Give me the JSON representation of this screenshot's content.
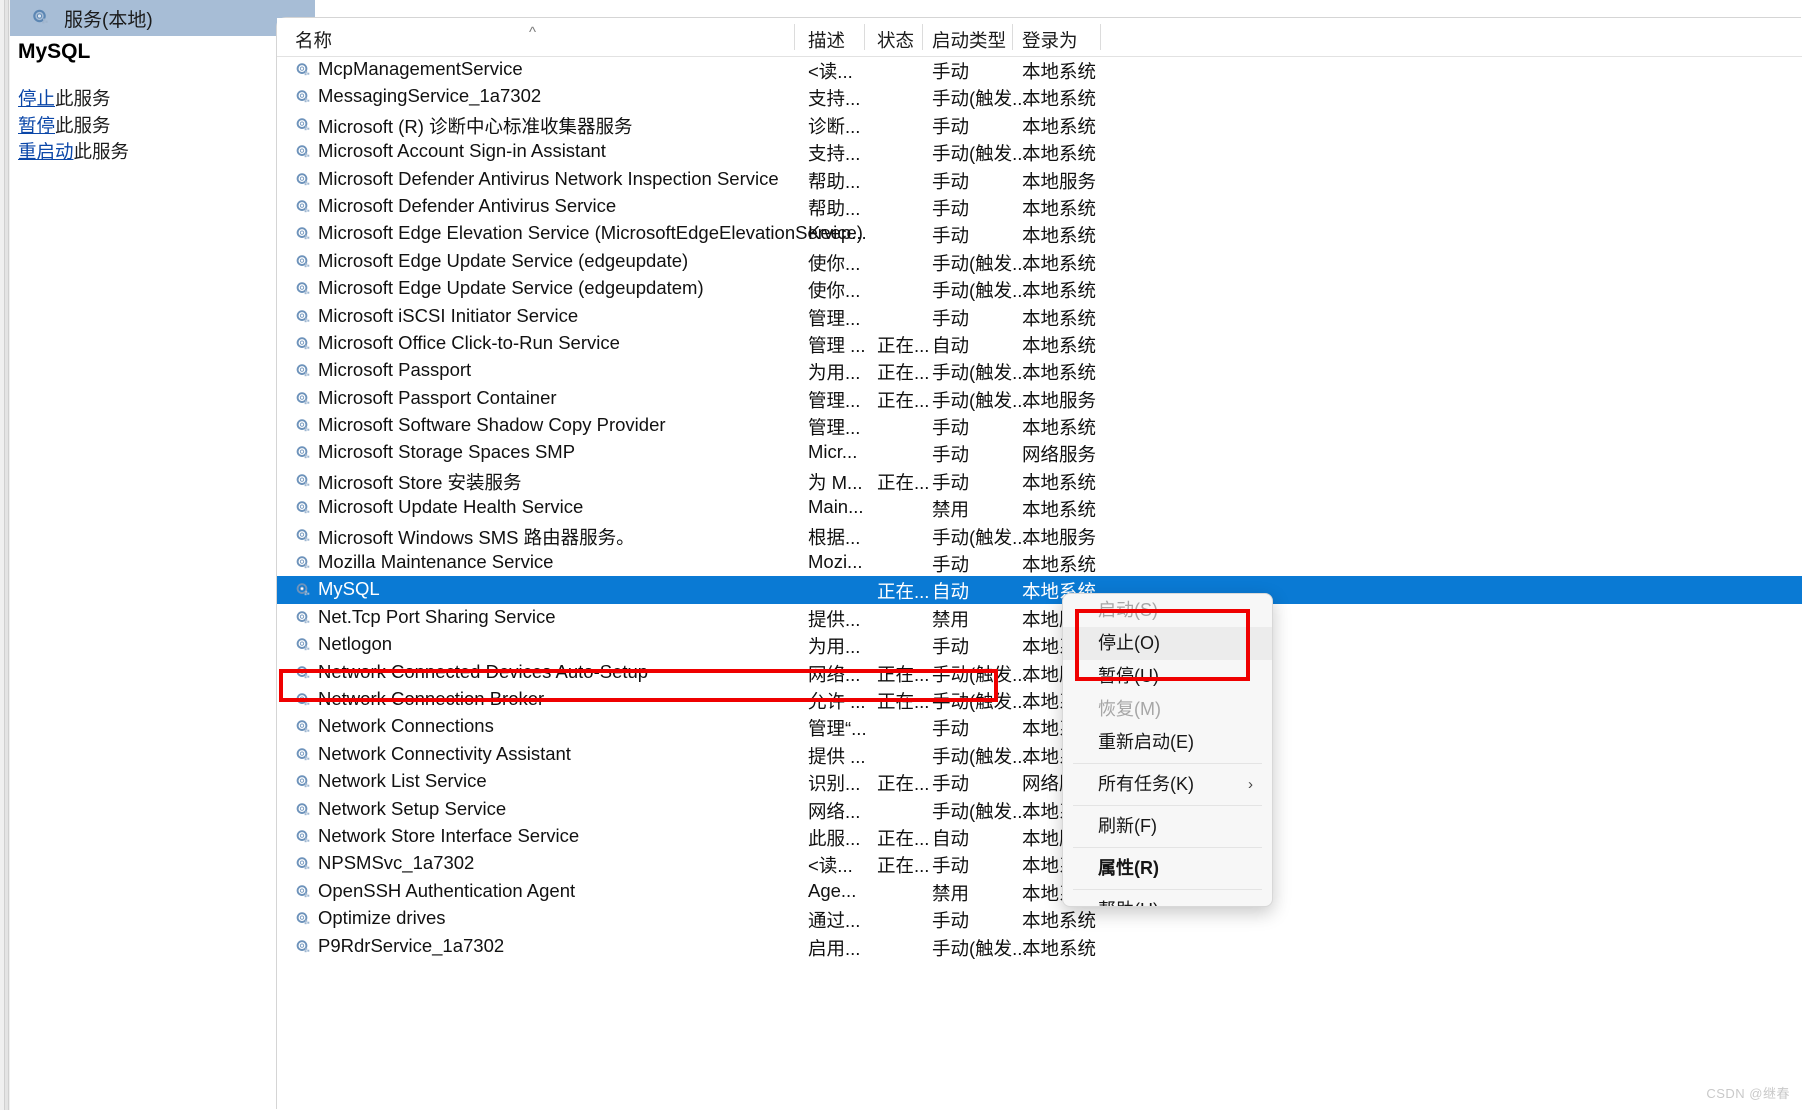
{
  "window": {
    "title": "服务(本地)",
    "title_icon": "services-gear-icon"
  },
  "details_pane": {
    "service_name": "MySQL",
    "links": [
      {
        "link_text": "停止",
        "suffix": "此服务"
      },
      {
        "link_text": "暂停",
        "suffix": "此服务"
      },
      {
        "link_text": "重启动",
        "suffix": "此服务"
      }
    ]
  },
  "list": {
    "sort_indicator": "^",
    "columns": [
      {
        "key": "name",
        "label": "名称"
      },
      {
        "key": "desc",
        "label": "描述"
      },
      {
        "key": "state",
        "label": "状态"
      },
      {
        "key": "start",
        "label": "启动类型"
      },
      {
        "key": "logon",
        "label": "登录为"
      }
    ],
    "rows": [
      {
        "name": "McpManagementService",
        "desc": "<读...",
        "state": "",
        "start": "手动",
        "logon": "本地系统",
        "selected": false
      },
      {
        "name": "MessagingService_1a7302",
        "desc": "支持...",
        "state": "",
        "start": "手动(触发...",
        "logon": "本地系统",
        "selected": false
      },
      {
        "name": "Microsoft (R) 诊断中心标准收集器服务",
        "desc": "诊断...",
        "state": "",
        "start": "手动",
        "logon": "本地系统",
        "selected": false
      },
      {
        "name": "Microsoft Account Sign-in Assistant",
        "desc": "支持...",
        "state": "",
        "start": "手动(触发...",
        "logon": "本地系统",
        "selected": false
      },
      {
        "name": "Microsoft Defender Antivirus Network Inspection Service",
        "desc": "帮助...",
        "state": "",
        "start": "手动",
        "logon": "本地服务",
        "selected": false
      },
      {
        "name": "Microsoft Defender Antivirus Service",
        "desc": "帮助...",
        "state": "",
        "start": "手动",
        "logon": "本地系统",
        "selected": false
      },
      {
        "name": "Microsoft Edge Elevation Service (MicrosoftEdgeElevationService)",
        "desc": "Keep...",
        "state": "",
        "start": "手动",
        "logon": "本地系统",
        "selected": false
      },
      {
        "name": "Microsoft Edge Update Service (edgeupdate)",
        "desc": "使你...",
        "state": "",
        "start": "手动(触发...",
        "logon": "本地系统",
        "selected": false
      },
      {
        "name": "Microsoft Edge Update Service (edgeupdatem)",
        "desc": "使你...",
        "state": "",
        "start": "手动(触发...",
        "logon": "本地系统",
        "selected": false
      },
      {
        "name": "Microsoft iSCSI Initiator Service",
        "desc": "管理...",
        "state": "",
        "start": "手动",
        "logon": "本地系统",
        "selected": false
      },
      {
        "name": "Microsoft Office Click-to-Run Service",
        "desc": "管理 ...",
        "state": "正在...",
        "start": "自动",
        "logon": "本地系统",
        "selected": false
      },
      {
        "name": "Microsoft Passport",
        "desc": "为用...",
        "state": "正在...",
        "start": "手动(触发...",
        "logon": "本地系统",
        "selected": false
      },
      {
        "name": "Microsoft Passport Container",
        "desc": "管理...",
        "state": "正在...",
        "start": "手动(触发...",
        "logon": "本地服务",
        "selected": false
      },
      {
        "name": "Microsoft Software Shadow Copy Provider",
        "desc": "管理...",
        "state": "",
        "start": "手动",
        "logon": "本地系统",
        "selected": false
      },
      {
        "name": "Microsoft Storage Spaces SMP",
        "desc": "Micr...",
        "state": "",
        "start": "手动",
        "logon": "网络服务",
        "selected": false
      },
      {
        "name": "Microsoft Store 安装服务",
        "desc": "为 M...",
        "state": "正在...",
        "start": "手动",
        "logon": "本地系统",
        "selected": false
      },
      {
        "name": "Microsoft Update Health Service",
        "desc": "Main...",
        "state": "",
        "start": "禁用",
        "logon": "本地系统",
        "selected": false
      },
      {
        "name": "Microsoft Windows SMS 路由器服务。",
        "desc": "根据...",
        "state": "",
        "start": "手动(触发...",
        "logon": "本地服务",
        "selected": false
      },
      {
        "name": "Mozilla Maintenance Service",
        "desc": "Mozi...",
        "state": "",
        "start": "手动",
        "logon": "本地系统",
        "selected": false
      },
      {
        "name": "MySQL",
        "desc": "",
        "state": "正在...",
        "start": "自动",
        "logon": "本地系统",
        "selected": true
      },
      {
        "name": "Net.Tcp Port Sharing Service",
        "desc": "提供...",
        "state": "",
        "start": "禁用",
        "logon": "本地服...",
        "selected": false
      },
      {
        "name": "Netlogon",
        "desc": "为用...",
        "state": "",
        "start": "手动",
        "logon": "本地系...",
        "selected": false
      },
      {
        "name": "Network Connected Devices Auto-Setup",
        "desc": "网络...",
        "state": "正在...",
        "start": "手动(触发...",
        "logon": "本地服...",
        "selected": false
      },
      {
        "name": "Network Connection Broker",
        "desc": "允许 ...",
        "state": "正在...",
        "start": "手动(触发...",
        "logon": "本地系...",
        "selected": false
      },
      {
        "name": "Network Connections",
        "desc": "管理“...",
        "state": "",
        "start": "手动",
        "logon": "本地系...",
        "selected": false
      },
      {
        "name": "Network Connectivity Assistant",
        "desc": "提供 ...",
        "state": "",
        "start": "手动(触发...",
        "logon": "本地系...",
        "selected": false
      },
      {
        "name": "Network List Service",
        "desc": "识别...",
        "state": "正在...",
        "start": "手动",
        "logon": "网络服...",
        "selected": false
      },
      {
        "name": "Network Setup Service",
        "desc": "网络...",
        "state": "",
        "start": "手动(触发...",
        "logon": "本地系...",
        "selected": false
      },
      {
        "name": "Network Store Interface Service",
        "desc": "此服...",
        "state": "正在...",
        "start": "自动",
        "logon": "本地服...",
        "selected": false
      },
      {
        "name": "NPSMSvc_1a7302",
        "desc": "<读...",
        "state": "正在...",
        "start": "手动",
        "logon": "本地系...",
        "selected": false
      },
      {
        "name": "OpenSSH Authentication Agent",
        "desc": "Age...",
        "state": "",
        "start": "禁用",
        "logon": "本地系...",
        "selected": false
      },
      {
        "name": "Optimize drives",
        "desc": "通过...",
        "state": "",
        "start": "手动",
        "logon": "本地系统",
        "selected": false
      },
      {
        "name": "P9RdrService_1a7302",
        "desc": "启用...",
        "state": "",
        "start": "手动(触发...",
        "logon": "本地系统",
        "selected": false
      }
    ]
  },
  "context_menu": {
    "items": [
      {
        "label": "启动(S)",
        "disabled": true,
        "bold": false,
        "hover": false,
        "submenu": false,
        "sep_after": false
      },
      {
        "label": "停止(O)",
        "disabled": false,
        "bold": false,
        "hover": true,
        "submenu": false,
        "sep_after": false
      },
      {
        "label": "暂停(U)",
        "disabled": false,
        "bold": false,
        "hover": false,
        "submenu": false,
        "sep_after": false
      },
      {
        "label": "恢复(M)",
        "disabled": true,
        "bold": false,
        "hover": false,
        "submenu": false,
        "sep_after": false
      },
      {
        "label": "重新启动(E)",
        "disabled": false,
        "bold": false,
        "hover": false,
        "submenu": false,
        "sep_after": true
      },
      {
        "label": "所有任务(K)",
        "disabled": false,
        "bold": false,
        "hover": false,
        "submenu": true,
        "sep_after": true
      },
      {
        "label": "刷新(F)",
        "disabled": false,
        "bold": false,
        "hover": false,
        "submenu": false,
        "sep_after": true
      },
      {
        "label": "属性(R)",
        "disabled": false,
        "bold": true,
        "hover": false,
        "submenu": false,
        "sep_after": true
      },
      {
        "label": "帮助(H)",
        "disabled": false,
        "bold": false,
        "hover": false,
        "submenu": false,
        "sep_after": false
      }
    ],
    "submenu_arrow": "›"
  },
  "annotations": {
    "highlight_color": "#ef0000",
    "selection_color": "#0a7ad4",
    "title_bar_color": "#a7bdd6",
    "link_color": "#0a46a8"
  },
  "watermark": "CSDN @继春"
}
